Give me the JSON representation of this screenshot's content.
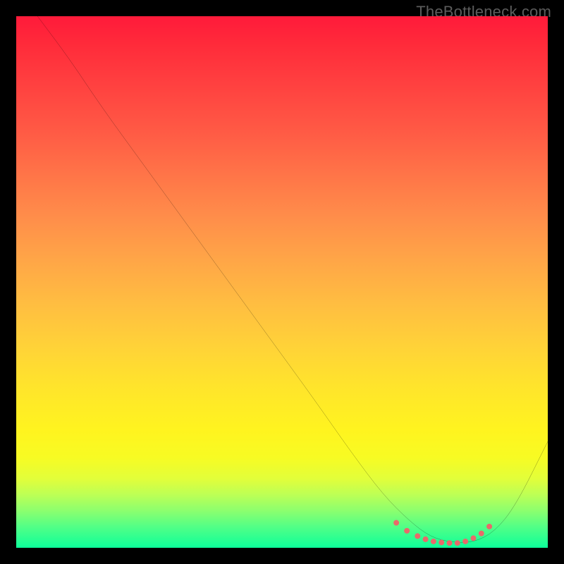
{
  "watermark": {
    "text": "TheBottleneck.com"
  },
  "chart_data": {
    "type": "line",
    "title": "",
    "xlabel": "",
    "ylabel": "",
    "xlim": [
      0,
      100
    ],
    "ylim": [
      0,
      100
    ],
    "grid": false,
    "series": [
      {
        "name": "curve",
        "color": "#000000",
        "x": [
          4,
          10,
          16,
          24,
          32,
          40,
          48,
          56,
          63,
          69,
          74,
          78,
          82,
          86,
          90,
          94,
          100
        ],
        "y": [
          100,
          92,
          83,
          72,
          61,
          50,
          39,
          28,
          18,
          10,
          5,
          2,
          1,
          1,
          3,
          8,
          20
        ]
      },
      {
        "name": "optimal-zone-markers",
        "color": "#e86a6a",
        "type": "scatter",
        "x": [
          71.5,
          73.5,
          75.5,
          77,
          78.5,
          80,
          81.5,
          83,
          84.5,
          86,
          87.5,
          89
        ],
        "y": [
          4.7,
          3.2,
          2.2,
          1.6,
          1.2,
          1.0,
          0.9,
          0.9,
          1.2,
          1.8,
          2.7,
          4.0
        ]
      }
    ],
    "background_gradient": {
      "top": "#ff1a3a",
      "mid": "#ffe52b",
      "bottom": "#0dff9a"
    }
  }
}
